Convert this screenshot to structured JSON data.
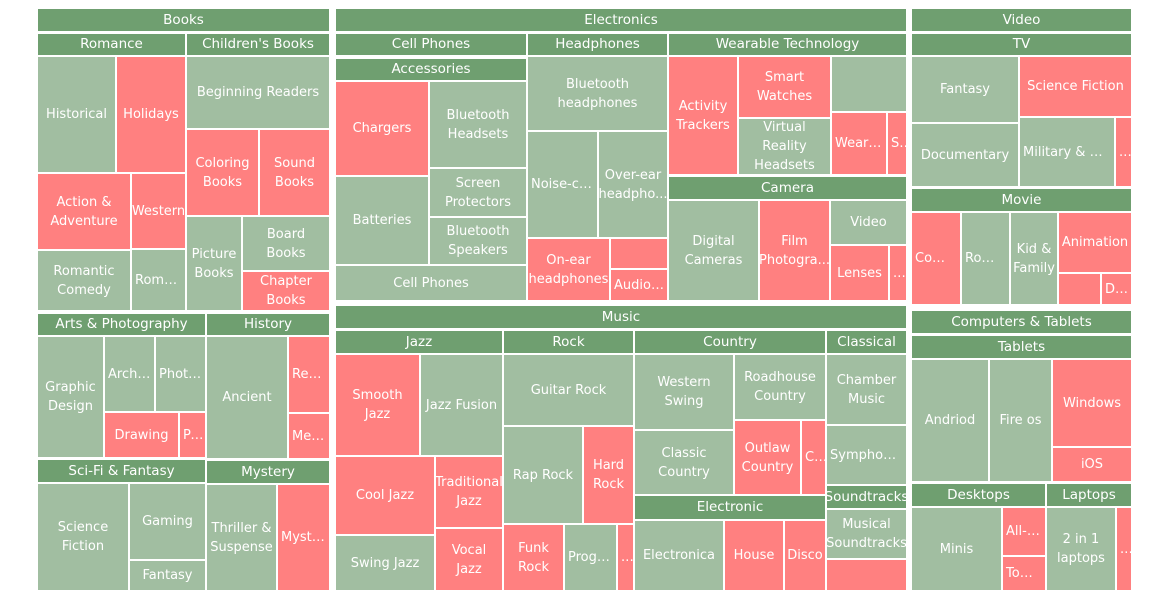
{
  "chart_data": {
    "type": "treemap",
    "title": "",
    "legend": "none",
    "color_scale": {
      "good": "#a1bea1",
      "bad": "#ff8080",
      "header": "#6f9f70"
    },
    "groups": [
      {
        "name": "Books",
        "children": [
          {
            "name": "Romance",
            "children": [
              {
                "name": "Historical",
                "status": "good"
              },
              {
                "name": "Holidays",
                "status": "bad"
              },
              {
                "name": "Action & Adventure",
                "status": "bad"
              },
              {
                "name": "Western",
                "status": "bad"
              },
              {
                "name": "Romantic Comedy",
                "status": "good"
              },
              {
                "name": "Roman...",
                "status": "good"
              }
            ]
          },
          {
            "name": "Children's Books",
            "children": [
              {
                "name": "Beginning Readers",
                "status": "good"
              },
              {
                "name": "Coloring Books",
                "status": "bad"
              },
              {
                "name": "Sound Books",
                "status": "bad"
              },
              {
                "name": "Picture Books",
                "status": "good"
              },
              {
                "name": "Board Books",
                "status": "good"
              },
              {
                "name": "Chapter Books",
                "status": "bad"
              }
            ]
          },
          {
            "name": "Arts & Photography",
            "children": [
              {
                "name": "Graphic Design",
                "status": "good"
              },
              {
                "name": "Archit...",
                "status": "good"
              },
              {
                "name": "Photo...",
                "status": "good"
              },
              {
                "name": "Drawing",
                "status": "bad"
              },
              {
                "name": "Pe...",
                "status": "bad"
              }
            ]
          },
          {
            "name": "History",
            "children": [
              {
                "name": "Ancient",
                "status": "good"
              },
              {
                "name": "Rena...",
                "status": "bad"
              },
              {
                "name": "Medi...",
                "status": "bad"
              }
            ]
          },
          {
            "name": "Sci-Fi & Fantasy",
            "children": [
              {
                "name": "Science Fiction",
                "status": "good"
              },
              {
                "name": "Gaming",
                "status": "good"
              },
              {
                "name": "Fantasy",
                "status": "good"
              }
            ]
          },
          {
            "name": "Mystery",
            "children": [
              {
                "name": "Thriller & Suspense",
                "status": "good"
              },
              {
                "name": "Mystery",
                "status": "bad"
              }
            ]
          }
        ]
      },
      {
        "name": "Electronics",
        "children": [
          {
            "name": "Cell Phones",
            "children": [
              {
                "name": "Accessories",
                "children": [
                  {
                    "name": "Chargers",
                    "status": "bad"
                  },
                  {
                    "name": "Bluetooth Headsets",
                    "status": "good"
                  },
                  {
                    "name": "Batteries",
                    "status": "good"
                  },
                  {
                    "name": "Screen Protectors",
                    "status": "good"
                  },
                  {
                    "name": "Bluetooth Speakers",
                    "status": "good"
                  }
                ]
              },
              {
                "name": "Cell Phones",
                "status": "good"
              }
            ]
          },
          {
            "name": "Headphones",
            "children": [
              {
                "name": "Bluetooth headphones",
                "status": "good"
              },
              {
                "name": "Noise-ca...",
                "status": "good"
              },
              {
                "name": "Over-ear headpho...",
                "status": "good"
              },
              {
                "name": "On-ear headphones",
                "status": "bad"
              },
              {
                "name": "",
                "status": "bad"
              },
              {
                "name": "Audiop...",
                "status": "bad"
              }
            ]
          },
          {
            "name": "Wearable Technology",
            "children": [
              {
                "name": "Activity Trackers",
                "status": "bad"
              },
              {
                "name": "Smart Watches",
                "status": "bad"
              },
              {
                "name": "",
                "status": "good"
              },
              {
                "name": "Virtual Reality Headsets",
                "status": "good"
              },
              {
                "name": "Weara...",
                "status": "bad"
              },
              {
                "name": "S...",
                "status": "bad"
              }
            ]
          },
          {
            "name": "Camera",
            "children": [
              {
                "name": "Digital Cameras",
                "status": "good"
              },
              {
                "name": "Film Photogra...",
                "status": "bad"
              },
              {
                "name": "Video",
                "status": "good"
              },
              {
                "name": "Lenses",
                "status": "bad"
              },
              {
                "name": "...",
                "status": "bad"
              }
            ]
          }
        ]
      },
      {
        "name": "Video",
        "children": [
          {
            "name": "TV",
            "children": [
              {
                "name": "Fantasy",
                "status": "good"
              },
              {
                "name": "Science Fiction",
                "status": "bad"
              },
              {
                "name": "Documentary",
                "status": "good"
              },
              {
                "name": "Military & War",
                "status": "good"
              },
              {
                "name": "...",
                "status": "bad"
              }
            ]
          },
          {
            "name": "Movie",
            "children": [
              {
                "name": "Come...",
                "status": "bad"
              },
              {
                "name": "Roma...",
                "status": "good"
              },
              {
                "name": "Kid & Family",
                "status": "good"
              },
              {
                "name": "Animation",
                "status": "bad"
              },
              {
                "name": "",
                "status": "bad"
              },
              {
                "name": "Dr...",
                "status": "bad"
              }
            ]
          }
        ]
      },
      {
        "name": "Music",
        "children": [
          {
            "name": "Jazz",
            "children": [
              {
                "name": "Smooth Jazz",
                "status": "bad"
              },
              {
                "name": "Jazz Fusion",
                "status": "good"
              },
              {
                "name": "Cool Jazz",
                "status": "bad"
              },
              {
                "name": "Traditional Jazz",
                "status": "bad"
              },
              {
                "name": "Swing Jazz",
                "status": "good"
              },
              {
                "name": "Vocal Jazz",
                "status": "bad"
              }
            ]
          },
          {
            "name": "Rock",
            "children": [
              {
                "name": "Guitar Rock",
                "status": "good"
              },
              {
                "name": "Rap Rock",
                "status": "good"
              },
              {
                "name": "Hard Rock",
                "status": "bad"
              },
              {
                "name": "Funk Rock",
                "status": "bad"
              },
              {
                "name": "Progre...",
                "status": "good"
              },
              {
                "name": "...",
                "status": "bad"
              }
            ]
          },
          {
            "name": "Country",
            "children": [
              {
                "name": "Western Swing",
                "status": "good"
              },
              {
                "name": "Roadhouse Country",
                "status": "good"
              },
              {
                "name": "Classic Country",
                "status": "good"
              },
              {
                "name": "Outlaw Country",
                "status": "bad"
              },
              {
                "name": "C...",
                "status": "bad"
              }
            ]
          },
          {
            "name": "Classical",
            "children": [
              {
                "name": "Chamber Music",
                "status": "good"
              },
              {
                "name": "Symphonies",
                "status": "good"
              }
            ]
          },
          {
            "name": "Soundtracks",
            "children": [
              {
                "name": "Musical Soundtracks",
                "status": "good"
              },
              {
                "name": "",
                "status": "bad"
              }
            ]
          },
          {
            "name": "Electronic",
            "children": [
              {
                "name": "Electronica",
                "status": "good"
              },
              {
                "name": "House",
                "status": "bad"
              },
              {
                "name": "Disco",
                "status": "bad"
              }
            ]
          }
        ]
      },
      {
        "name": "Computers & Tablets",
        "children": [
          {
            "name": "Tablets",
            "children": [
              {
                "name": "Andriod",
                "status": "good"
              },
              {
                "name": "Fire os",
                "status": "good"
              },
              {
                "name": "Windows",
                "status": "bad"
              },
              {
                "name": "iOS",
                "status": "bad"
              }
            ]
          },
          {
            "name": "Desktops",
            "children": [
              {
                "name": "Minis",
                "status": "good"
              },
              {
                "name": "All-in...",
                "status": "bad"
              },
              {
                "name": "Towe...",
                "status": "bad"
              }
            ]
          },
          {
            "name": "Laptops",
            "children": [
              {
                "name": "2 in 1 laptops",
                "status": "good"
              },
              {
                "name": "...",
                "status": "bad"
              }
            ]
          }
        ]
      }
    ]
  }
}
